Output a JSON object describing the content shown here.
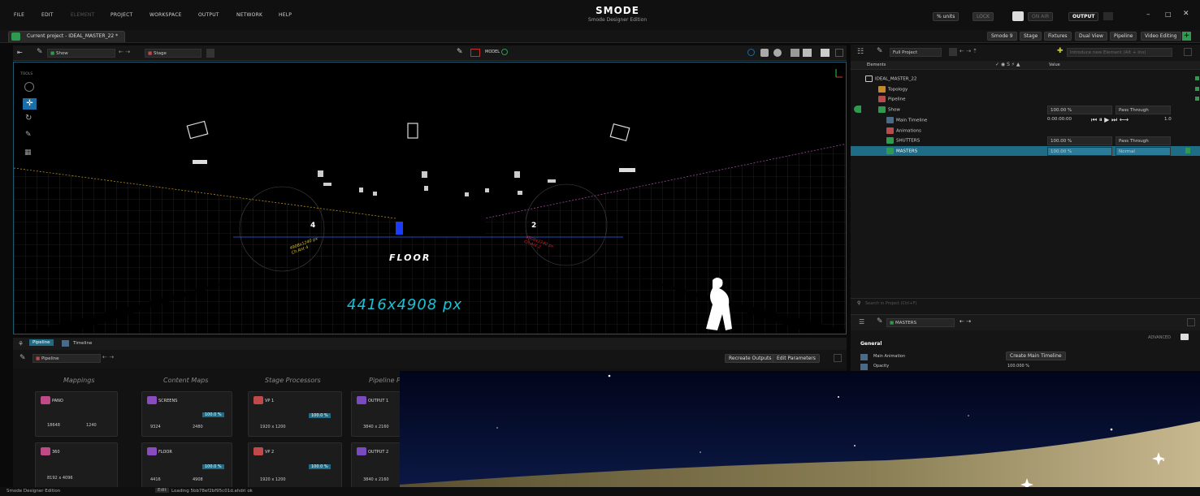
{
  "menu": [
    "FILE",
    "EDIT",
    "ELEMENT",
    "PROJECT",
    "WORKSPACE",
    "OUTPUT",
    "NETWORK",
    "HELP"
  ],
  "logo": {
    "name": "SMODE",
    "edition": "Smode Designer Edition"
  },
  "top_right": {
    "units": "% units",
    "lock": "LOCK",
    "on_air": "ON AIR",
    "output": "OUTPUT"
  },
  "project_tab": "Current project - IDEAL_MASTER_22 *",
  "workspaces": [
    "Smode 9",
    "Stage",
    "Fixtures",
    "Dual View",
    "Pipeline",
    "Video Editing"
  ],
  "viewport_toolbar": {
    "show": "Show",
    "stage": "Stage",
    "model": "MODEL"
  },
  "tools_label": "TOOLS",
  "scene": {
    "floor": "FLOOR",
    "size": "4416x4908 px",
    "label4": "4",
    "label2": "2",
    "left_info": "4908x1240 px\nCh.Ant 4",
    "right_info": "4908x1240 px\nCh.Ant 2"
  },
  "elements_panel": {
    "filter": "Full Project",
    "search_placeholder": "Introduce new Element (Alt + Ins)",
    "col_elements": "Elements",
    "col_value": "Value",
    "rows": [
      {
        "label": "IDEAL_MASTER_22",
        "color": "#888",
        "v1": "",
        "v2": ""
      },
      {
        "label": "Topology",
        "color": "#c8882a",
        "v1": "",
        "v2": ""
      },
      {
        "label": "Pipeline",
        "color": "#b84b4b",
        "v1": "",
        "v2": ""
      },
      {
        "label": "Show",
        "color": "#2e9a4e",
        "v1": "100.00 %",
        "v2": "Pass Through"
      },
      {
        "label": "Main Timeline",
        "color": "#4a6a8a",
        "v1": "0:00:00:00",
        "v2": "1.0"
      },
      {
        "label": "Animations",
        "color": "#b84b4b",
        "v1": "",
        "v2": ""
      },
      {
        "label": "SHUTTERS",
        "color": "#2e9a4e",
        "v1": "100.00 %",
        "v2": "Pass Through"
      },
      {
        "label": "MASTERS",
        "color": "#2e9a4e",
        "v1": "100.00 %",
        "v2": "Normal"
      }
    ]
  },
  "search_bottom": "Search in Project (Ctrl+F)",
  "inspector": {
    "name": "MASTERS",
    "advanced": "ADVANCED",
    "section": "General",
    "p1": "Main Animation",
    "p1v": "Create Main Timeline",
    "p2": "Opacity",
    "p2v": "100.000 %"
  },
  "bottom_tabs": {
    "pipeline": "Pipeline",
    "timeline": "Timeline",
    "crumb": "Pipeline",
    "recreate": "Recreate Outputs",
    "edit": "Edit Parameters"
  },
  "columns": [
    "Mappings",
    "Content Maps",
    "Stage Processors",
    "Pipeline P"
  ],
  "nodes": [
    {
      "title": "PANO",
      "color": "#c04a86",
      "a": "18648",
      "b": "1240"
    },
    {
      "title": "SCREENS",
      "color": "#8a4ac0",
      "a": "9324",
      "b": "2480"
    },
    {
      "title": "VP 1",
      "color": "#c04a4a",
      "a": "1920 x 1200",
      "b": ""
    },
    {
      "title": "OUTPUT 1",
      "color": "#7a4ac0",
      "a": "3840 x 2160",
      "b": ""
    },
    {
      "title": "360",
      "color": "#c04a86",
      "a": "8192 x 4096",
      "b": ""
    },
    {
      "title": "FLOOR",
      "color": "#8a4ac0",
      "a": "4416",
      "b": "4908"
    },
    {
      "title": "VP 2",
      "color": "#c04a4a",
      "a": "1920 x 1200",
      "b": ""
    },
    {
      "title": "OUTPUT 2",
      "color": "#7a4ac0",
      "a": "3840 x 2160",
      "b": ""
    }
  ],
  "node_pct": "100.0 %",
  "status": {
    "left": "Smode Designer Edition",
    "edit": "Edit",
    "msg": "Loading 5bb78ef2bf95c01d.ahdri ok"
  },
  "colors": {
    "accent": "#19c2d6",
    "selection": "#1f6c86",
    "onair": "#3a3a3a"
  }
}
